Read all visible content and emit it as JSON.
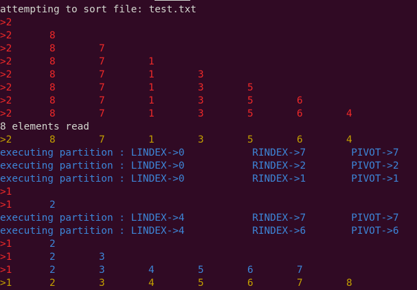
{
  "terminal": {
    "colors": {
      "background": "#300a24",
      "default": "#d3d7cf",
      "red": "#ef2929",
      "yellow": "#c4a000",
      "blue": "#3d86d8"
    },
    "lines": [
      {
        "segments": [
          {
            "text": "attempting to sort file: test.txt",
            "color": "default",
            "col": 0
          }
        ]
      },
      {
        "segments": [
          {
            "text": ">2",
            "color": "red",
            "col": 0
          }
        ]
      },
      {
        "segments": [
          {
            "text": ">2",
            "color": "red",
            "col": 0
          },
          {
            "text": "8",
            "color": "red",
            "col": 10
          }
        ]
      },
      {
        "segments": [
          {
            "text": ">2",
            "color": "red",
            "col": 0
          },
          {
            "text": "8",
            "color": "red",
            "col": 10
          },
          {
            "text": "7",
            "color": "red",
            "col": 20
          }
        ]
      },
      {
        "segments": [
          {
            "text": ">2",
            "color": "red",
            "col": 0
          },
          {
            "text": "8",
            "color": "red",
            "col": 10
          },
          {
            "text": "7",
            "color": "red",
            "col": 20
          },
          {
            "text": "1",
            "color": "red",
            "col": 30
          }
        ]
      },
      {
        "segments": [
          {
            "text": ">2",
            "color": "red",
            "col": 0
          },
          {
            "text": "8",
            "color": "red",
            "col": 10
          },
          {
            "text": "7",
            "color": "red",
            "col": 20
          },
          {
            "text": "1",
            "color": "red",
            "col": 30
          },
          {
            "text": "3",
            "color": "red",
            "col": 40
          }
        ]
      },
      {
        "segments": [
          {
            "text": ">2",
            "color": "red",
            "col": 0
          },
          {
            "text": "8",
            "color": "red",
            "col": 10
          },
          {
            "text": "7",
            "color": "red",
            "col": 20
          },
          {
            "text": "1",
            "color": "red",
            "col": 30
          },
          {
            "text": "3",
            "color": "red",
            "col": 40
          },
          {
            "text": "5",
            "color": "red",
            "col": 50
          }
        ]
      },
      {
        "segments": [
          {
            "text": ">2",
            "color": "red",
            "col": 0
          },
          {
            "text": "8",
            "color": "red",
            "col": 10
          },
          {
            "text": "7",
            "color": "red",
            "col": 20
          },
          {
            "text": "1",
            "color": "red",
            "col": 30
          },
          {
            "text": "3",
            "color": "red",
            "col": 40
          },
          {
            "text": "5",
            "color": "red",
            "col": 50
          },
          {
            "text": "6",
            "color": "red",
            "col": 60
          }
        ]
      },
      {
        "segments": [
          {
            "text": ">2",
            "color": "red",
            "col": 0
          },
          {
            "text": "8",
            "color": "red",
            "col": 10
          },
          {
            "text": "7",
            "color": "red",
            "col": 20
          },
          {
            "text": "1",
            "color": "red",
            "col": 30
          },
          {
            "text": "3",
            "color": "red",
            "col": 40
          },
          {
            "text": "5",
            "color": "red",
            "col": 50
          },
          {
            "text": "6",
            "color": "red",
            "col": 60
          },
          {
            "text": "4",
            "color": "red",
            "col": 70
          }
        ]
      },
      {
        "segments": [
          {
            "text": "8 elements read",
            "color": "default",
            "col": 0
          }
        ]
      },
      {
        "segments": [
          {
            "text": ">2",
            "color": "yellow",
            "col": 0
          },
          {
            "text": "8",
            "color": "yellow",
            "col": 10
          },
          {
            "text": "7",
            "color": "yellow",
            "col": 20
          },
          {
            "text": "1",
            "color": "yellow",
            "col": 30
          },
          {
            "text": "3",
            "color": "yellow",
            "col": 40
          },
          {
            "text": "5",
            "color": "yellow",
            "col": 50
          },
          {
            "text": "6",
            "color": "yellow",
            "col": 60
          },
          {
            "text": "4",
            "color": "yellow",
            "col": 70
          }
        ]
      },
      {
        "segments": [
          {
            "text": "executing partition : LINDEX->0",
            "color": "blue",
            "col": 0
          },
          {
            "text": "RINDEX->7",
            "color": "blue",
            "col": 51
          },
          {
            "text": "PIVOT->7",
            "color": "blue",
            "col": 71
          }
        ]
      },
      {
        "segments": [
          {
            "text": "executing partition : LINDEX->0",
            "color": "blue",
            "col": 0
          },
          {
            "text": "RINDEX->2",
            "color": "blue",
            "col": 51
          },
          {
            "text": "PIVOT->2",
            "color": "blue",
            "col": 71
          }
        ]
      },
      {
        "segments": [
          {
            "text": "executing partition : LINDEX->0",
            "color": "blue",
            "col": 0
          },
          {
            "text": "RINDEX->1",
            "color": "blue",
            "col": 51
          },
          {
            "text": "PIVOT->1",
            "color": "blue",
            "col": 71
          }
        ]
      },
      {
        "segments": [
          {
            "text": ">1",
            "color": "red",
            "col": 0
          }
        ]
      },
      {
        "segments": [
          {
            "text": ">1",
            "color": "red",
            "col": 0
          },
          {
            "text": "2",
            "color": "blue",
            "col": 10
          }
        ]
      },
      {
        "segments": [
          {
            "text": "executing partition : LINDEX->4",
            "color": "blue",
            "col": 0
          },
          {
            "text": "RINDEX->7",
            "color": "blue",
            "col": 51
          },
          {
            "text": "PIVOT->7",
            "color": "blue",
            "col": 71
          }
        ]
      },
      {
        "segments": [
          {
            "text": "executing partition : LINDEX->4",
            "color": "blue",
            "col": 0
          },
          {
            "text": "RINDEX->6",
            "color": "blue",
            "col": 51
          },
          {
            "text": "PIVOT->6",
            "color": "blue",
            "col": 71
          }
        ]
      },
      {
        "segments": [
          {
            "text": ">1",
            "color": "red",
            "col": 0
          },
          {
            "text": "2",
            "color": "blue",
            "col": 10
          }
        ]
      },
      {
        "segments": [
          {
            "text": ">1",
            "color": "red",
            "col": 0
          },
          {
            "text": "2",
            "color": "blue",
            "col": 10
          },
          {
            "text": "3",
            "color": "blue",
            "col": 20
          }
        ]
      },
      {
        "segments": [
          {
            "text": ">1",
            "color": "red",
            "col": 0
          },
          {
            "text": "2",
            "color": "blue",
            "col": 10
          },
          {
            "text": "3",
            "color": "blue",
            "col": 20
          },
          {
            "text": "4",
            "color": "blue",
            "col": 30
          },
          {
            "text": "5",
            "color": "blue",
            "col": 40
          },
          {
            "text": "6",
            "color": "blue",
            "col": 50
          },
          {
            "text": "7",
            "color": "blue",
            "col": 60
          }
        ]
      },
      {
        "segments": [
          {
            "text": ">1",
            "color": "yellow",
            "col": 0
          },
          {
            "text": "2",
            "color": "yellow",
            "col": 10
          },
          {
            "text": "3",
            "color": "yellow",
            "col": 20
          },
          {
            "text": "4",
            "color": "yellow",
            "col": 30
          },
          {
            "text": "5",
            "color": "yellow",
            "col": 40
          },
          {
            "text": "6",
            "color": "yellow",
            "col": 50
          },
          {
            "text": "7",
            "color": "yellow",
            "col": 60
          },
          {
            "text": "8",
            "color": "yellow",
            "col": 70
          }
        ]
      }
    ]
  }
}
